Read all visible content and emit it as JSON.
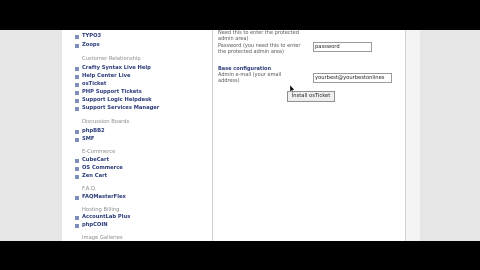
{
  "left_nav": {
    "items_top": [
      {
        "label": "TYPO3"
      },
      {
        "label": "Zoops"
      }
    ],
    "categories": [
      {
        "title": "Customer Relationship",
        "items": [
          "Crafty Syntax Live Help",
          "Help Center Live",
          "osTicket",
          "PHP Support Tickets",
          "Support Logic Helpdesk",
          "Support Services Manager"
        ]
      },
      {
        "title": "Discussion Boards",
        "items": [
          "phpBB2",
          "SMF"
        ]
      },
      {
        "title": "E-Commerce",
        "items": [
          "CubeCart",
          "OS Commerce",
          "Zen Cart"
        ]
      },
      {
        "title": "F.A.Q.",
        "items": [
          "FAQMasterFlex"
        ]
      },
      {
        "title": "Hosting Billing",
        "items": [
          "AccountLab Plus",
          "phpCOIN"
        ]
      },
      {
        "title": "Image Galleries",
        "items": []
      }
    ]
  },
  "form": {
    "line_need_enter": "Need this to enter the protected",
    "line_admin_area": "admin area)",
    "password_label_1": "Password (you need this to enter",
    "password_label_2": "the protected admin area)",
    "password_value": "password",
    "base_config_title": "Base configuration",
    "admin_email_label_1": "Admin e-mail (your email",
    "admin_email_label_2": "address)",
    "admin_email_value": "yourbest@yourbestonlines",
    "install_button": "Install osTicket"
  }
}
